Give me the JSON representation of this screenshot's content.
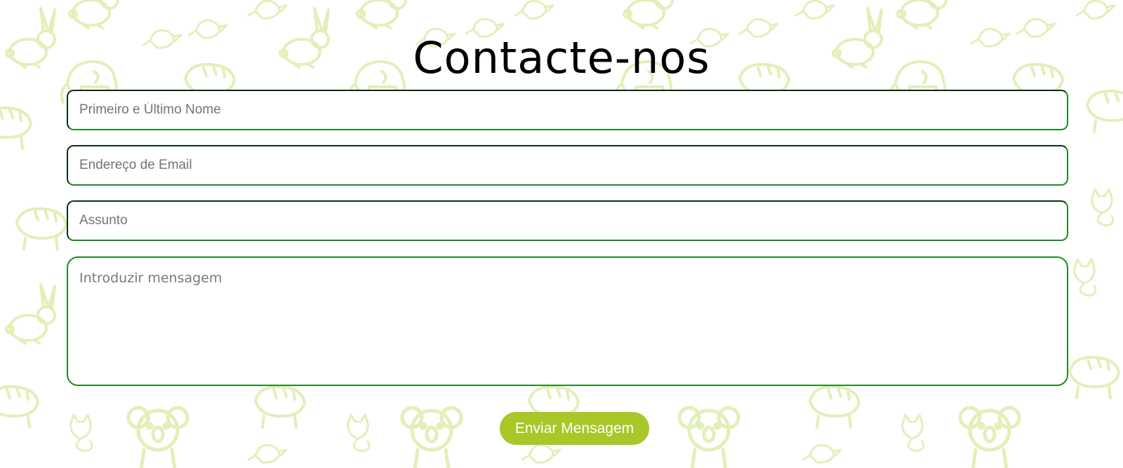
{
  "page": {
    "title": "Contacte-nos"
  },
  "form": {
    "name_placeholder": "Primeiro e Último Nome",
    "email_placeholder": "Endereço de Email",
    "subject_placeholder": "Assunto",
    "message_placeholder": "Introduzir mensagem",
    "submit_label": "Enviar Mensagem"
  },
  "colors": {
    "accent": "#a7c828",
    "field_border": "#1f8a23",
    "pattern": "#e3efb9",
    "title": "#000000"
  },
  "background": {
    "pattern_icons": [
      "rabbit-icon",
      "elephant-icon",
      "tiger-icon",
      "koala-icon",
      "fox-icon",
      "bird-icon",
      "cat-icon",
      "mouse-icon"
    ]
  }
}
